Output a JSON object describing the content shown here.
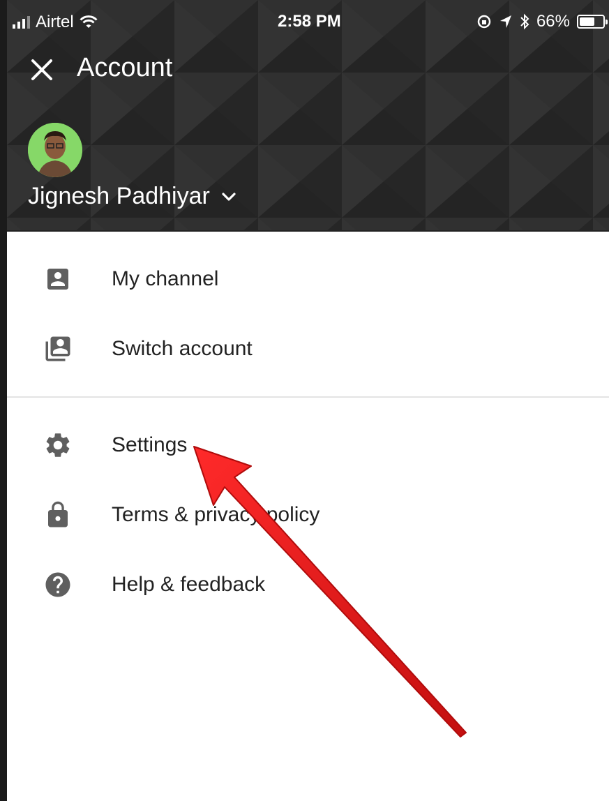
{
  "status_bar": {
    "carrier": "Airtel",
    "time": "2:58 PM",
    "battery": "66%",
    "battery_level": 0.66
  },
  "header": {
    "close_icon": "close-icon",
    "title": "Account",
    "account_name": "Jignesh Padhiyar",
    "dropdown_icon": "chevron-down-icon"
  },
  "menu": {
    "items": [
      {
        "label": "My channel",
        "icon": "account-box-icon"
      },
      {
        "label": "Switch account",
        "icon": "switch-account-icon"
      },
      {
        "label": "Settings",
        "icon": "gear-icon"
      },
      {
        "label": "Terms & privacy policy",
        "icon": "lock-icon"
      },
      {
        "label": "Help & feedback",
        "icon": "help-icon"
      }
    ]
  },
  "colors": {
    "header_bg": "#2b2b2b",
    "icon": "#5f5f5f",
    "text": "#222222",
    "annotation_arrow": "#d91a1a"
  }
}
